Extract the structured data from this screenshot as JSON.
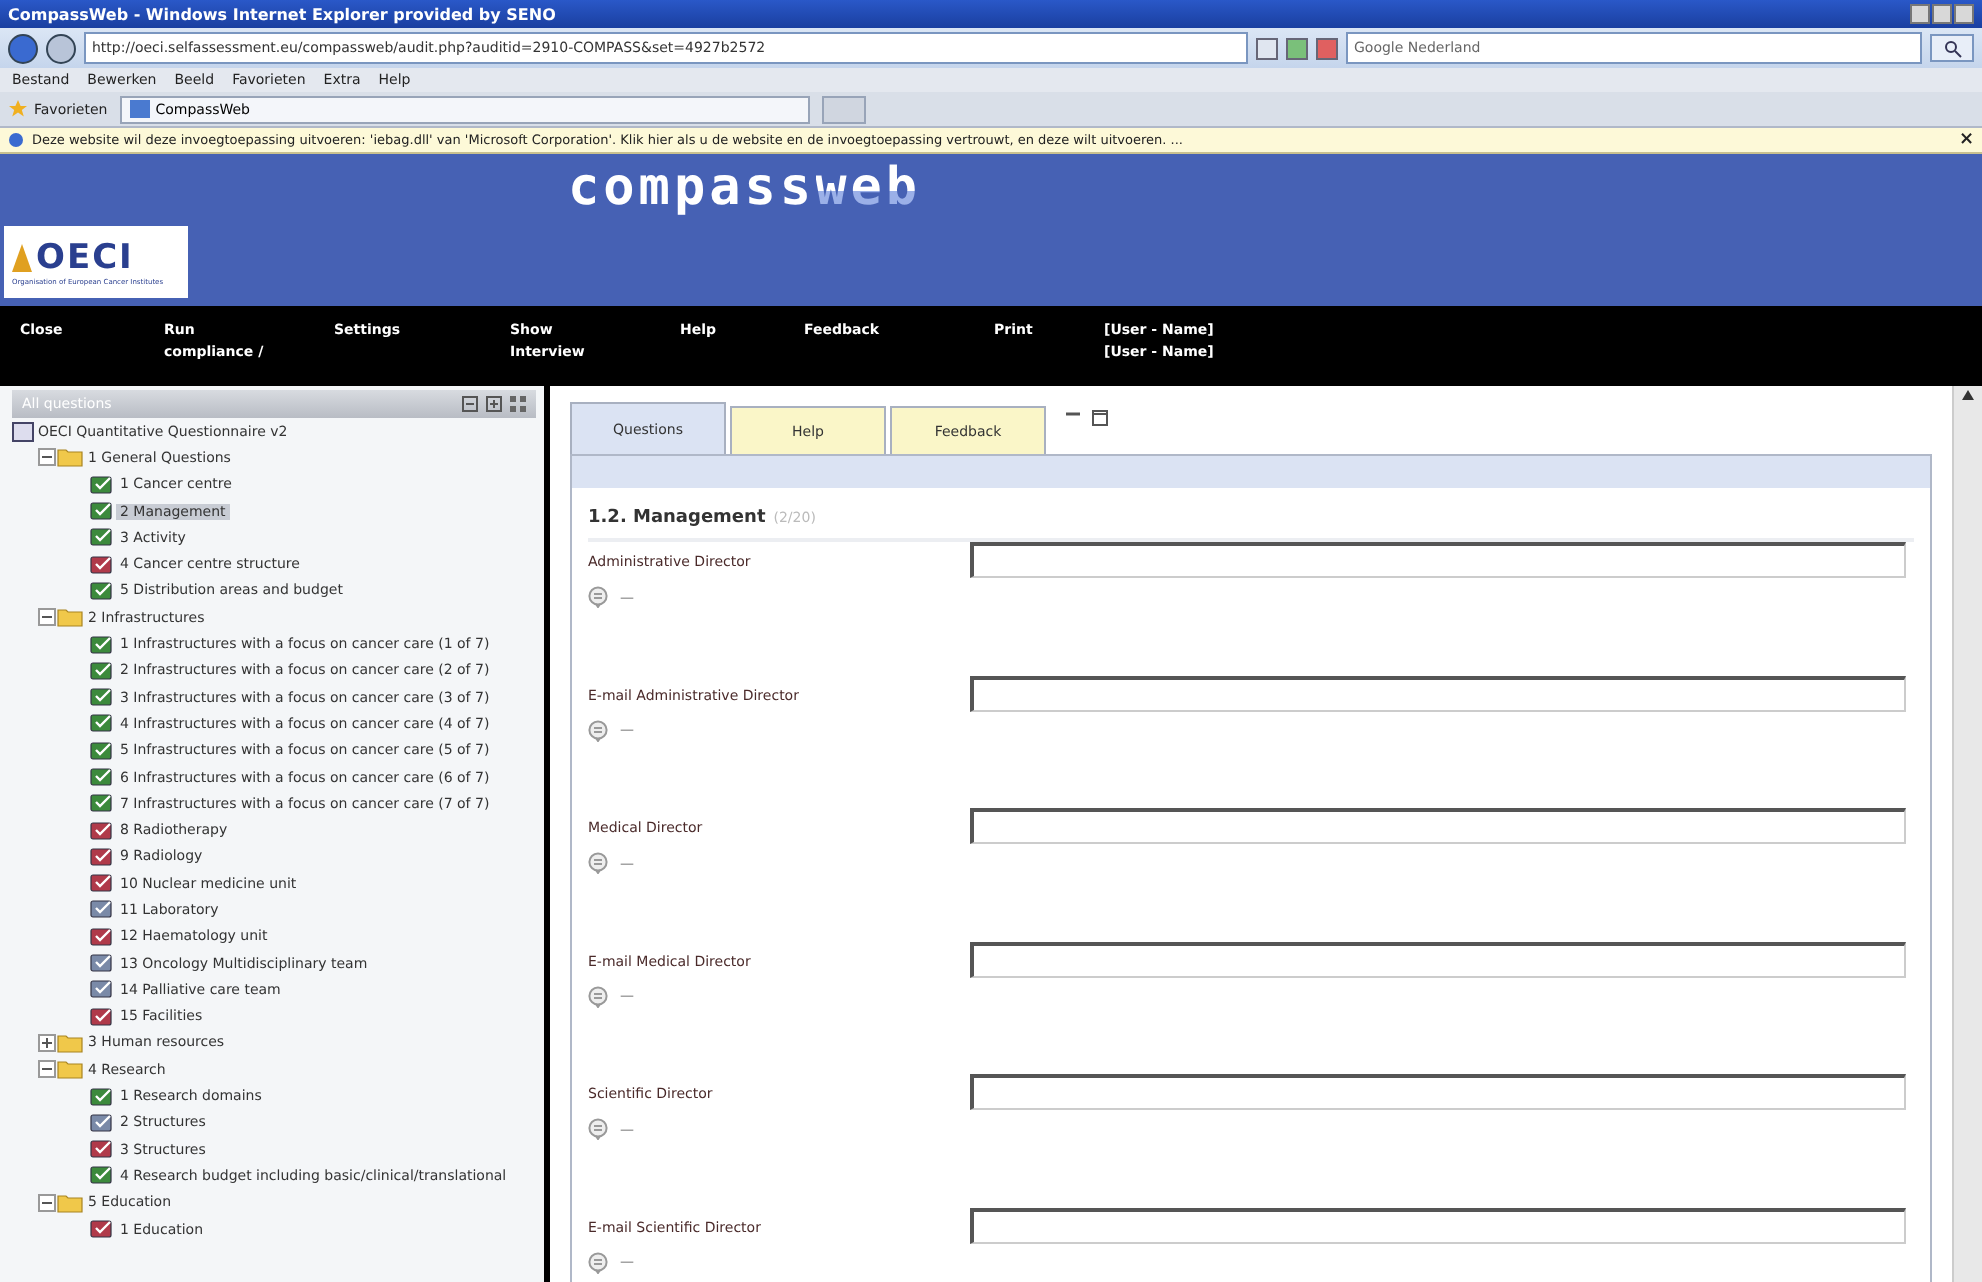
{
  "window": {
    "title": "CompassWeb - Windows Internet Explorer provided by SENO"
  },
  "address_bar": {
    "url": "http://oeci.selfassessment.eu/compassweb/audit.php?auditid=2910-COMPASS&set=4927b2572",
    "search_placeholder": "Google Nederland"
  },
  "menu": [
    "Bestand",
    "Bewerken",
    "Beeld",
    "Favorieten",
    "Extra",
    "Help"
  ],
  "favorites_bar": {
    "label": "Favorieten",
    "tabs": [
      {
        "label": "CompassWeb",
        "selected": true
      }
    ]
  },
  "info_bar": {
    "text": "Deze website wil deze invoegtoepassing uitvoeren: 'iebag.dll' van 'Microsoft Corporation'. Klik hier als u de website en de invoegtoepassing vertrouwt, en deze wilt uitvoeren. ...",
    "close": "×"
  },
  "banner": {
    "logo": "OECI",
    "logo_subtitle": "Organisation of European Cancer Institutes",
    "brand_left": "compass",
    "brand_right": "web"
  },
  "nav": [
    "Close",
    "Run compliance /",
    "Settings",
    "Show Interview",
    "Help",
    "Feedback",
    "Print",
    "[User - Name] [User - Name]"
  ],
  "tree": {
    "title": "All questions",
    "root": {
      "label": "OECI Quantitative Questionnaire v2",
      "children": [
        {
          "kind": "folder",
          "label": "1 General Questions",
          "expanded": true,
          "children": [
            {
              "kind": "page",
              "label": "1 Cancer centre",
              "color": "#3c8a3c",
              "selected": false
            },
            {
              "kind": "page",
              "label": "2 Management",
              "color": "#3c8a3c",
              "selected": true
            },
            {
              "kind": "page",
              "label": "3 Activity",
              "color": "#3c8a3c",
              "selected": false
            },
            {
              "kind": "page",
              "label": "4 Cancer centre structure",
              "color": "#b03a4a",
              "selected": false
            },
            {
              "kind": "page",
              "label": "5 Distribution areas and budget",
              "color": "#3c8a3c",
              "selected": false
            }
          ]
        },
        {
          "kind": "folder",
          "label": "2 Infrastructures",
          "expanded": true,
          "children": [
            {
              "kind": "page",
              "label": "1 Infrastructures with a focus on cancer care (1 of 7)",
              "color": "#3c8a3c",
              "selected": false
            },
            {
              "kind": "page",
              "label": "2 Infrastructures with a focus on cancer care (2 of 7)",
              "color": "#3c8a3c",
              "selected": false
            },
            {
              "kind": "page",
              "label": "3 Infrastructures with a focus on cancer care (3 of 7)",
              "color": "#3c8a3c",
              "selected": false
            },
            {
              "kind": "page",
              "label": "4 Infrastructures with a focus on cancer care (4 of 7)",
              "color": "#3c8a3c",
              "selected": false
            },
            {
              "kind": "page",
              "label": "5 Infrastructures with a focus on cancer care (5 of 7)",
              "color": "#3c8a3c",
              "selected": false
            },
            {
              "kind": "page",
              "label": "6 Infrastructures with a focus on cancer care (6 of 7)",
              "color": "#3c8a3c",
              "selected": false
            },
            {
              "kind": "page",
              "label": "7 Infrastructures with a focus on cancer care (7 of 7)",
              "color": "#3c8a3c",
              "selected": false
            },
            {
              "kind": "page",
              "label": "8 Radiotherapy",
              "color": "#b03a4a",
              "selected": false
            },
            {
              "kind": "page",
              "label": "9 Radiology",
              "color": "#b03a4a",
              "selected": false
            },
            {
              "kind": "page",
              "label": "10 Nuclear medicine unit",
              "color": "#b03a4a",
              "selected": false
            },
            {
              "kind": "page",
              "label": "11 Laboratory",
              "color": "#7a8aa8",
              "selected": false
            },
            {
              "kind": "page",
              "label": "12 Haematology unit",
              "color": "#b03a4a",
              "selected": false
            },
            {
              "kind": "page",
              "label": "13 Oncology Multidisciplinary team",
              "color": "#7a8aa8",
              "selected": false
            },
            {
              "kind": "page",
              "label": "14 Palliative care team",
              "color": "#7a8aa8",
              "selected": false
            },
            {
              "kind": "page",
              "label": "15 Facilities",
              "color": "#b03a4a",
              "selected": false
            }
          ]
        },
        {
          "kind": "folder",
          "label": "3 Human resources",
          "expanded": false
        },
        {
          "kind": "folder",
          "label": "4 Research",
          "expanded": true,
          "children": [
            {
              "kind": "page",
              "label": "1 Research domains",
              "color": "#3c8a3c",
              "selected": false
            },
            {
              "kind": "page",
              "label": "2 Structures",
              "color": "#7a8aa8",
              "selected": false
            },
            {
              "kind": "page",
              "label": "3 Structures",
              "color": "#b03a4a",
              "selected": false
            },
            {
              "kind": "page",
              "label": "4 Research budget including basic/clinical/translational",
              "color": "#3c8a3c",
              "selected": false
            }
          ]
        },
        {
          "kind": "folder",
          "label": "5 Education",
          "expanded": true,
          "children": [
            {
              "kind": "page",
              "label": "1 Education",
              "color": "#b03a4a",
              "selected": false
            }
          ]
        }
      ]
    }
  },
  "tabs": [
    {
      "label": "Questions",
      "selected": true
    },
    {
      "label": "Help",
      "selected": false
    },
    {
      "label": "Feedback",
      "selected": false
    }
  ],
  "section": {
    "title": "1.2. Management",
    "count": "(2/20)"
  },
  "fields": [
    {
      "label": "Administrative Director",
      "note": "—"
    },
    {
      "label": "E-mail Administrative Director",
      "note": "—"
    },
    {
      "label": "Medical Director",
      "note": "—"
    },
    {
      "label": "E-mail Medical Director",
      "note": "—"
    },
    {
      "label": "Scientific Director",
      "note": "—"
    },
    {
      "label": "E-mail Scientific Director",
      "note": "—"
    }
  ]
}
